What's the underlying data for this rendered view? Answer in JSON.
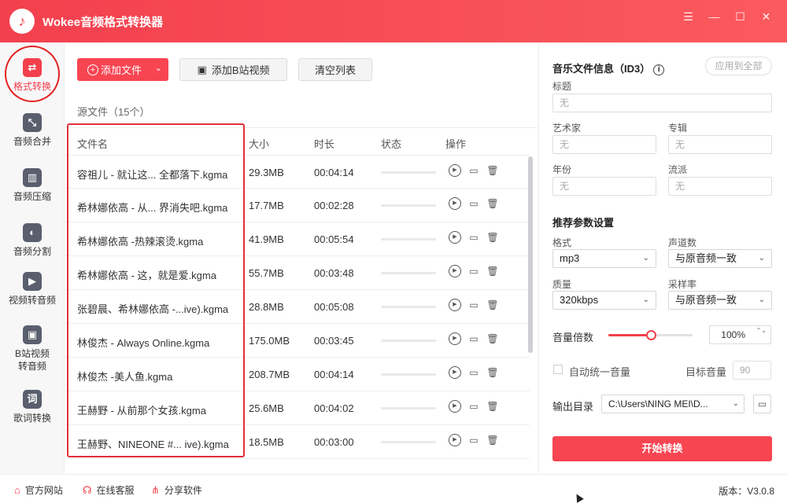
{
  "app": {
    "title": "Wokee音频格式转换器",
    "logo_glyph": "♪",
    "window_controls": [
      {
        "icon": "menu-icon",
        "glyph": "☰"
      },
      {
        "icon": "minimize-icon",
        "glyph": "—"
      },
      {
        "icon": "maximize-icon",
        "glyph": "☐"
      },
      {
        "icon": "close-icon",
        "glyph": "✕"
      }
    ]
  },
  "sidebar": {
    "items": [
      {
        "label": "格式转换",
        "icon": "convert-icon",
        "glyph": "⇄",
        "active": true
      },
      {
        "label": "音频合并",
        "icon": "merge-icon",
        "glyph": "⤡"
      },
      {
        "label": "音频压缩",
        "icon": "compress-icon",
        "glyph": "▥"
      },
      {
        "label": "音频分割",
        "icon": "split-icon",
        "glyph": "◐"
      },
      {
        "label": "视频转音频",
        "icon": "video-icon",
        "glyph": "▶"
      },
      {
        "label": "B站视频转音频",
        "icon": "bilibili-icon",
        "glyph": "▣"
      },
      {
        "label": "歌词转换",
        "icon": "lyrics-icon",
        "glyph": "词"
      }
    ]
  },
  "toolbar": {
    "add_file_label": "添加文件",
    "add_file_plus": "+",
    "add_file_caret": "⌄",
    "add_bilibili_label": "添加B站视频",
    "add_bilibili_icon": "▣",
    "clear_label": "清空列表"
  },
  "files": {
    "source_count_label": "源文件（15个）",
    "columns": [
      "文件名",
      "大小",
      "时长",
      "状态",
      "操作"
    ],
    "rows": [
      {
        "name": "容祖儿 - 就让这... 全都落下.kgma",
        "size": "29.3MB",
        "duration": "00:04:14"
      },
      {
        "name": "希林娜依高 - 从... 界消失吧.kgma",
        "size": "17.7MB",
        "duration": "00:02:28"
      },
      {
        "name": "希林娜依高 -热辣滚烫.kgma",
        "size": "41.9MB",
        "duration": "00:05:54"
      },
      {
        "name": "希林娜依高 - 这，就是爱.kgma",
        "size": "55.7MB",
        "duration": "00:03:48"
      },
      {
        "name": "张碧晨、希林娜依高 -...ive).kgma",
        "size": "28.8MB",
        "duration": "00:05:08"
      },
      {
        "name": "林俊杰 - Always Online.kgma",
        "size": "175.0MB",
        "duration": "00:03:45"
      },
      {
        "name": "林俊杰 -美人鱼.kgma",
        "size": "208.7MB",
        "duration": "00:04:14"
      },
      {
        "name": "王赫野 - 从前那个女孩.kgma",
        "size": "25.6MB",
        "duration": "00:04:02"
      },
      {
        "name": "王赫野、NINEONE #... ive).kgma",
        "size": "18.5MB",
        "duration": "00:03:00"
      }
    ],
    "op_glyphs": {
      "play": "▶",
      "folder": "▭",
      "delete": "🗑"
    }
  },
  "id3": {
    "title": "音乐文件信息（ID3）",
    "info_glyph": "i",
    "apply_all_label": "应用到全部",
    "fields": {
      "title_label": "标题",
      "title_placeholder": "无",
      "artist_label": "艺术家",
      "artist_placeholder": "无",
      "album_label": "专辑",
      "album_placeholder": "无",
      "year_label": "年份",
      "year_placeholder": "无",
      "genre_label": "流派",
      "genre_placeholder": "无"
    }
  },
  "params": {
    "title": "推荐参数设置",
    "format_label": "格式",
    "format_value": "mp3",
    "channels_label": "声道数",
    "channels_value": "与原音频一致",
    "quality_label": "质量",
    "quality_value": "320kbps",
    "samplerate_label": "采样率",
    "samplerate_value": "与原音频一致",
    "select_chev": "⌄",
    "volume_label": "音量倍数",
    "volume_value": "100%",
    "volume_slider_level": 0.5,
    "volume_spin": "⌃⌄",
    "auto_volume_label": "自动统一音量",
    "auto_volume_checked": false,
    "target_volume_label": "目标音量",
    "target_volume_value": "90",
    "output_label": "输出目录",
    "output_path": "C:\\Users\\NING MEI\\D...",
    "folder_glyph": "▭",
    "start_label": "开始转换"
  },
  "footer": {
    "links": [
      {
        "label": "官方网站",
        "icon": "home-icon",
        "glyph": "⌂"
      },
      {
        "label": "在线客服",
        "icon": "headset-icon",
        "glyph": "☊"
      },
      {
        "label": "分享软件",
        "icon": "share-icon",
        "glyph": "⋔"
      }
    ],
    "version": "版本：V3.0.8"
  },
  "colors": {
    "accent": "#f2404c",
    "highlight_annotation": "#e12f36"
  }
}
